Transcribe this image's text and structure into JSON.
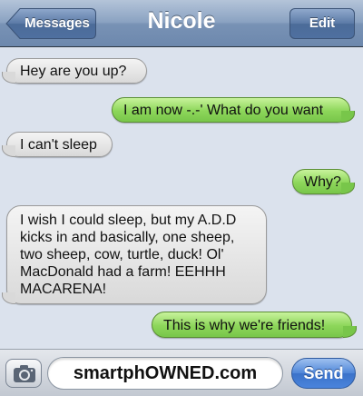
{
  "header": {
    "back_label": "Messages",
    "title": "Nicole",
    "edit_label": "Edit"
  },
  "messages": [
    {
      "direction": "received",
      "text": "Hey are you up?"
    },
    {
      "direction": "sent",
      "text": "I am now -.-' What do you want"
    },
    {
      "direction": "received",
      "text": "I can't sleep"
    },
    {
      "direction": "sent",
      "text": "Why?"
    },
    {
      "direction": "received",
      "text": "I wish I could sleep, but my A.D.D kicks in and basically, one sheep, two sheep, cow, turtle, duck! Ol' MacDonald had a farm! EEHHH MACARENA!"
    },
    {
      "direction": "sent",
      "text": "This is why we're friends!"
    }
  ],
  "composer": {
    "camera_icon": "camera-icon",
    "field_text": "smartphOWNED.com",
    "send_label": "Send"
  },
  "colors": {
    "received_bubble": "#e6e6e6",
    "sent_bubble": "#8dd65a",
    "background": "#dbe2ed",
    "nav_bar": "#7892b5",
    "send_button": "#4a84dc"
  }
}
